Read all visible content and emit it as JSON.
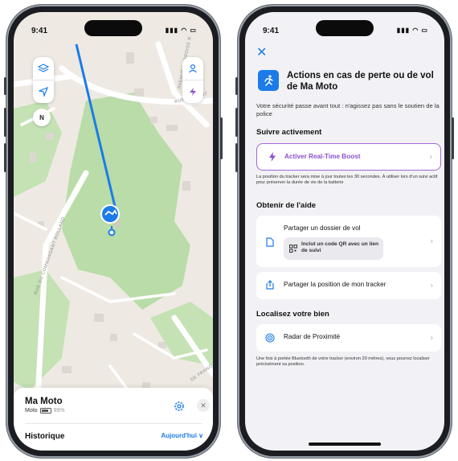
{
  "status": {
    "time": "9:41",
    "icons": "▮▮▮ ◠ ▭"
  },
  "left": {
    "compass": "N",
    "streets": {
      "avenue": "AVENUE AMBROISE R",
      "dumont": "RUE DUMONT",
      "commandant": "RUE DU COMMANDANT ROLLAND",
      "france": "DE FRANC"
    },
    "sheet": {
      "name": "Ma Moto",
      "type": "Moto",
      "battery": "99%",
      "history": "Historique",
      "date_filter": "Aujourd'hui ∨"
    },
    "controls": {
      "close": "✕"
    }
  },
  "right": {
    "close": "✕",
    "title": "Actions en cas de perte ou de vol de Ma Moto",
    "warning": "Votre sécurité passe avant tout : n'agissez pas sans le soutien de la police",
    "sections": {
      "follow": "Suivre activement",
      "help": "Obtenir de l'aide",
      "locate": "Localisez votre bien"
    },
    "boost": {
      "label": "Activer Real-Time Boost",
      "note": "La position du tracker sera mise à jour toutes les 30 secondes. À utiliser lors d'un suivi actif pour préserver la durée de vie de la batterie"
    },
    "share_file": {
      "label": "Partager un dossier de vol",
      "badge": "Inclut un code QR avec un lien de suivi"
    },
    "share_pos": {
      "label": "Partager la position de mon tracker"
    },
    "radar": {
      "label": "Radar de Proximité",
      "note": "Une fois à portée Bluetooth de votre tracker (environ 20 mètres), vous pourrez localiser précisément sa position."
    },
    "chevron": "›"
  },
  "colors": {
    "accent": "#1c7be8",
    "boost_border": "#a169d8",
    "boost_text": "#8b4fd0",
    "park": "#b9dca8"
  }
}
